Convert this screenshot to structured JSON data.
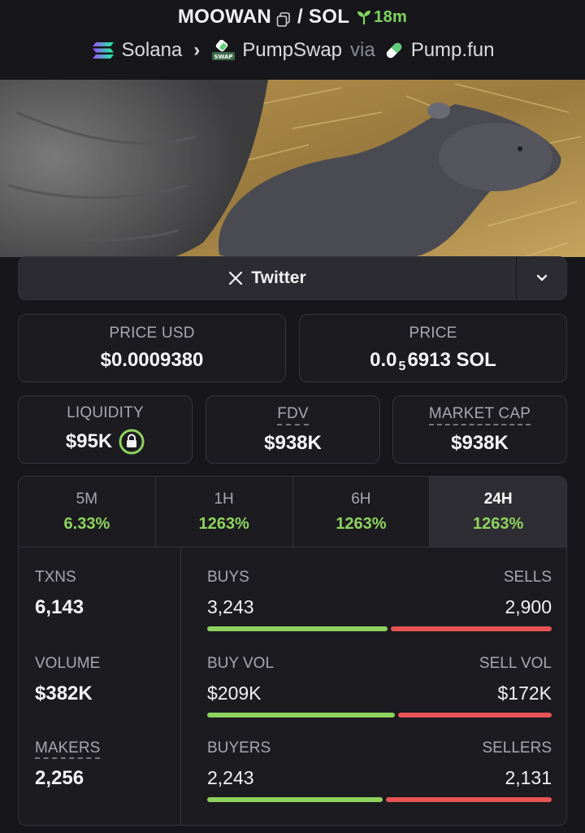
{
  "header": {
    "token": "MOOWAN",
    "pair_quote": "/ SOL",
    "age": "18m",
    "chain": "Solana",
    "dex": "PumpSwap",
    "via": "via",
    "launchpad": "Pump.fun",
    "dex_badge": "SWAP"
  },
  "twitter_button": {
    "label": "Twitter",
    "icon": "x-logo-icon"
  },
  "price_usd": {
    "label": "PRICE USD",
    "value": "$0.0009380"
  },
  "price_native": {
    "label": "PRICE",
    "prefix": "0.0",
    "subscript": "5",
    "suffix": "6913 SOL"
  },
  "liquidity": {
    "label": "LIQUIDITY",
    "value": "$95K",
    "icon": "lock-icon"
  },
  "fdv": {
    "label": "FDV",
    "value": "$938K"
  },
  "market_cap": {
    "label": "MARKET CAP",
    "value": "$938K"
  },
  "tabs": [
    {
      "label": "5M",
      "value": "6.33%"
    },
    {
      "label": "1H",
      "value": "1263%"
    },
    {
      "label": "6H",
      "value": "1263%"
    },
    {
      "label": "24H",
      "value": "1263%",
      "active": true
    }
  ],
  "txns": {
    "label": "TXNS",
    "value": "6,143"
  },
  "volume": {
    "label": "VOLUME",
    "value": "$382K"
  },
  "makers": {
    "label": "MAKERS",
    "value": "2,256"
  },
  "buys": {
    "label": "BUYS",
    "value": "3,243",
    "fraction": 0.528
  },
  "sells": {
    "label": "SELLS",
    "value": "2,900"
  },
  "buy_vol": {
    "label": "BUY VOL",
    "value": "$209K",
    "fraction": 0.549
  },
  "sell_vol": {
    "label": "SELL VOL",
    "value": "$172K"
  },
  "buyers": {
    "label": "BUYERS",
    "value": "2,243",
    "fraction": 0.513
  },
  "sellers": {
    "label": "SELLERS",
    "value": "2,131"
  },
  "colors": {
    "positive": "#8fd35f",
    "negative": "#e85454",
    "age": "#7fd45e"
  }
}
